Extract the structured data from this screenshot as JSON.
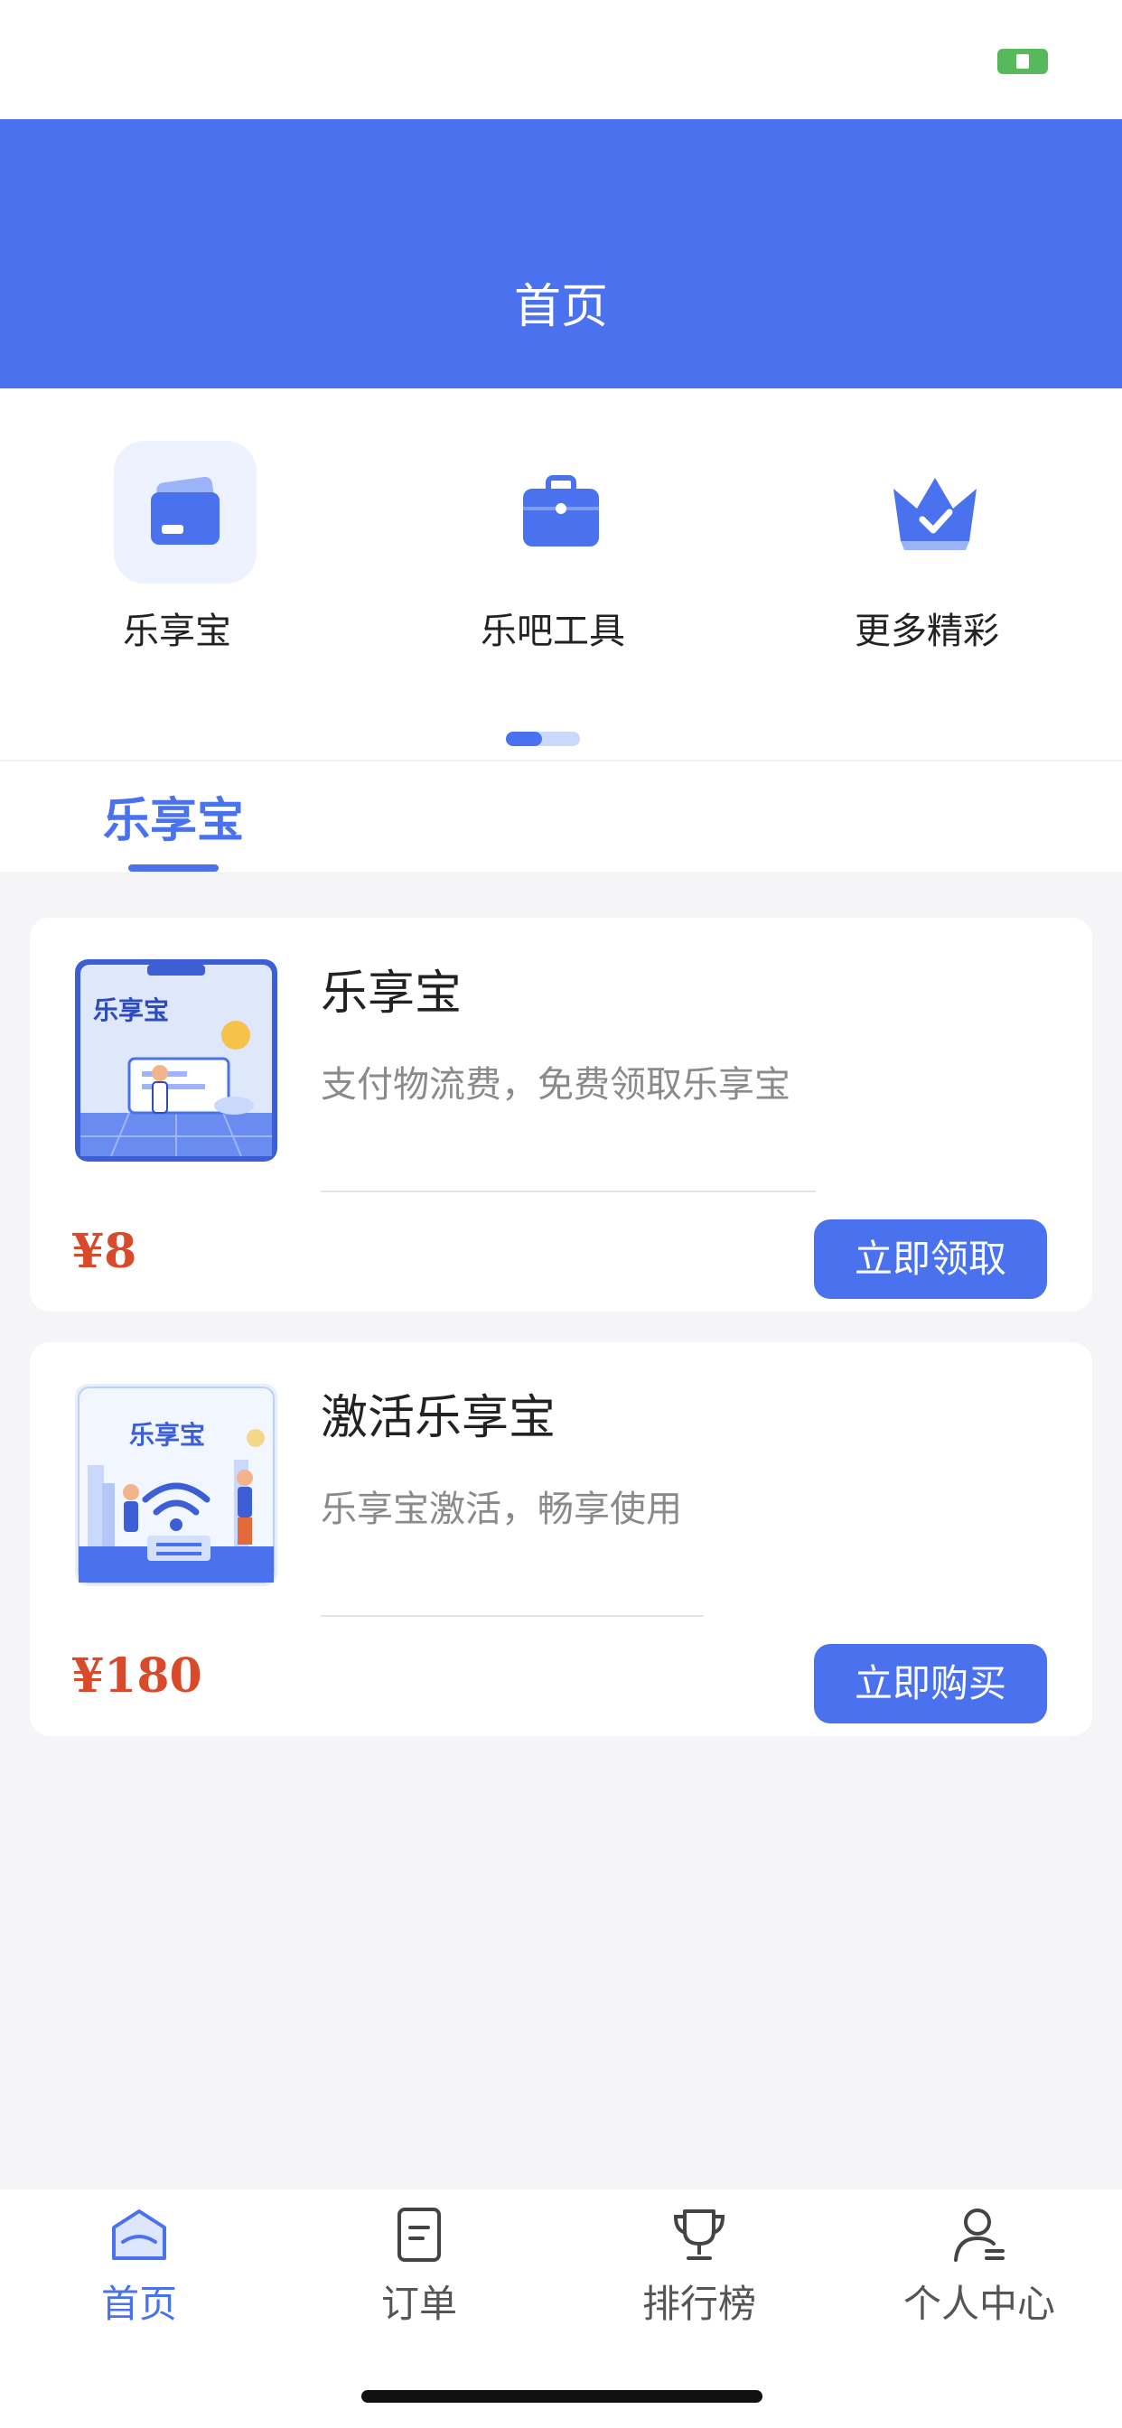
{
  "header": {
    "title": "首页"
  },
  "quick_nav": [
    {
      "label": "乐享宝",
      "icon": "card-icon"
    },
    {
      "label": "乐吧工具",
      "icon": "toolbox-icon"
    },
    {
      "label": "更多精彩",
      "icon": "crown-icon"
    }
  ],
  "page_indicator": {
    "current": 1,
    "total": 2
  },
  "tabs": [
    {
      "label": "乐享宝",
      "active": true
    }
  ],
  "products": [
    {
      "title": "乐享宝",
      "description": "支付物流费，免费领取乐享宝",
      "price": "¥8",
      "button": "立即领取",
      "thumb_text": "乐享宝"
    },
    {
      "title": "激活乐享宝",
      "description": "乐享宝激活，畅享使用",
      "price": "¥180",
      "button": "立即购买",
      "thumb_text": "乐享宝"
    }
  ],
  "tabbar": [
    {
      "label": "首页",
      "icon": "home-icon",
      "active": true
    },
    {
      "label": "订单",
      "icon": "order-icon",
      "active": false
    },
    {
      "label": "排行榜",
      "icon": "trophy-icon",
      "active": false
    },
    {
      "label": "个人中心",
      "icon": "user-icon",
      "active": false
    }
  ],
  "colors": {
    "primary": "#4a72ee",
    "price": "#d94a2b",
    "background": "#f5f5f7"
  }
}
